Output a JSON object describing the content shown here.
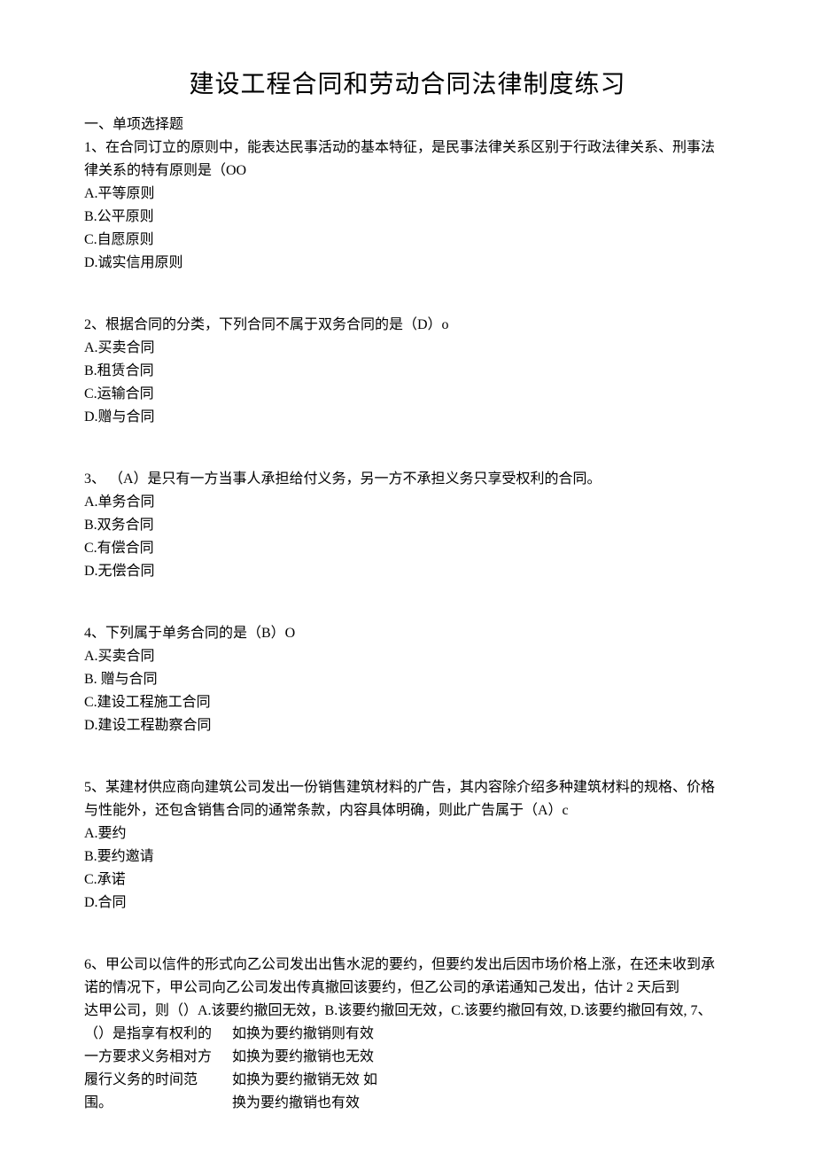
{
  "title": "建设工程合同和劳动合同法律制度练习",
  "sectionHeader": "一、单项选择题",
  "q1": {
    "line1": "1、在合同订立的原则中，能表达民事活动的基本特征，是民事法律关系区别于行政法律关系、刑事法",
    "line2": "律关系的特有原则是（OO",
    "a": "A.平等原则",
    "b": "B.公平原则",
    "c": "C.自愿原则",
    "d": "D.诚实信用原则"
  },
  "q2": {
    "text": "2、根据合同的分类，下列合同不属于双务合同的是（D）o",
    "a": "A.买卖合同",
    "b": "B.租赁合同",
    "c": "C.运输合同",
    "d": "D.赠与合同"
  },
  "q3": {
    "text": "3、 （A）是只有一方当事人承担给付义务，另一方不承担义务只享受权利的合同。",
    "a": "A.单务合同",
    "b": "B.双务合同",
    "c": "C.有偿合同",
    "d": "D.无偿合同"
  },
  "q4": {
    "text": "4、下列属于单务合同的是（B）O",
    "a": "A.买卖合同",
    "b": "B. 赠与合同",
    "c": "C.建设工程施工合同",
    "d": "D.建设工程勘察合同"
  },
  "q5": {
    "line1": "5、某建材供应商向建筑公司发出一份销售建筑材料的广告，其内容除介绍多种建筑材料的规格、价格",
    "line2": "与性能外，还包含销售合同的通常条款，内容具体明确，则此广告属于（A）c",
    "a": "A.要约",
    "b": "B.要约邀请",
    "c": "C.承诺",
    "d": "D.合同"
  },
  "q6": {
    "line1": "6、甲公司以信件的形式向乙公司发出出售水泥的要约，但要约发出后因市场价格上涨，在还未收到承",
    "line2": "诺的情况下，甲公司向乙公司发出传真撤回该要约，但乙公司的承诺通知己发出，估计 2 天后到",
    "line3": "达甲公司，则（）A.该要约撤回无效，B.该要约撤回无效，C.该要约撤回有效, D.该要约撤回有效, 7、",
    "left1": "（）是指享有权利的",
    "left2": "一方要求义务相对方",
    "left3": "履行义务的时间范",
    "left4": "围。",
    "right1": "如换为要约撤销则有效",
    "right2": "如换为要约撤销也无效",
    "right3": "如换为要约撤销无效 如",
    "right4": "换为要约撤销也有效"
  }
}
